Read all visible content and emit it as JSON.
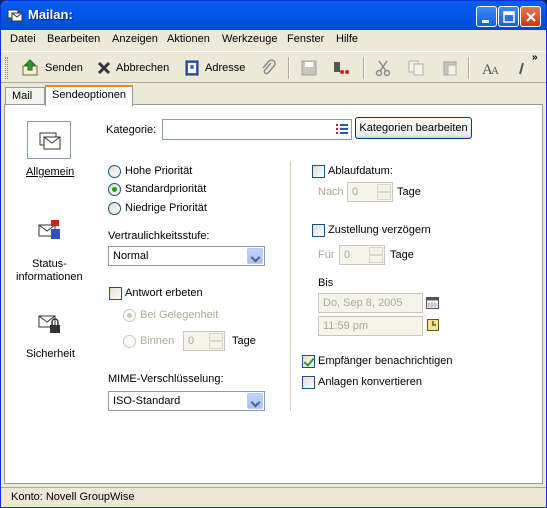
{
  "window": {
    "title": "Mailan:"
  },
  "menu": [
    "Datei",
    "Bearbeiten",
    "Anzeigen",
    "Aktionen",
    "Werkzeuge",
    "Fenster",
    "Hilfe"
  ],
  "toolbar": {
    "send_label": "Senden",
    "cancel_label": "Abbrechen",
    "address_label": "Adresse",
    "overflow": "»"
  },
  "tabs": [
    {
      "label": "Mail",
      "active": false
    },
    {
      "label": "Sendeoptionen",
      "active": true
    }
  ],
  "nav": {
    "general": "Allgemein",
    "status_line1": "Status-",
    "status_line2": "informationen",
    "security": "Sicherheit"
  },
  "category": {
    "label": "Kategorie:",
    "value": "",
    "edit_button": "Kategorien bearbeiten"
  },
  "priority": {
    "options": [
      "Hohe Priorität",
      "Standardpriorität",
      "Niedrige Priorität"
    ],
    "selected": "Standardpriorität"
  },
  "confidentiality": {
    "label": "Vertraulichkeitsstufe:",
    "value": "Normal"
  },
  "reply": {
    "label": "Antwort erbeten",
    "checked": false,
    "option_when_convenient": "Bei Gelegenheit",
    "option_within": "Binnen",
    "within_value": "0",
    "days_label": "Tage"
  },
  "mime": {
    "label": "MIME-Verschlüsselung:",
    "value": "ISO-Standard"
  },
  "expiration": {
    "label": "Ablaufdatum:",
    "checked": false,
    "after_label": "Nach",
    "after_value": "0",
    "days_label": "Tage"
  },
  "delay": {
    "label": "Zustellung verzögern",
    "checked": false,
    "for_label": "Für",
    "for_value": "0",
    "days_label": "Tage",
    "until_label": "Bis",
    "date_value": "Do, Sep 8, 2005",
    "time_value": "11:59 pm"
  },
  "notify": {
    "label": "Empfänger benachrichtigen",
    "checked": true
  },
  "convert": {
    "label": "Anlagen konvertieren",
    "checked": false
  },
  "status": {
    "text": "Konto: Novell GroupWise"
  },
  "colors": {
    "titlebar": "#0058EE",
    "tab_accent": "#E68B2C",
    "check": "#21A121"
  }
}
